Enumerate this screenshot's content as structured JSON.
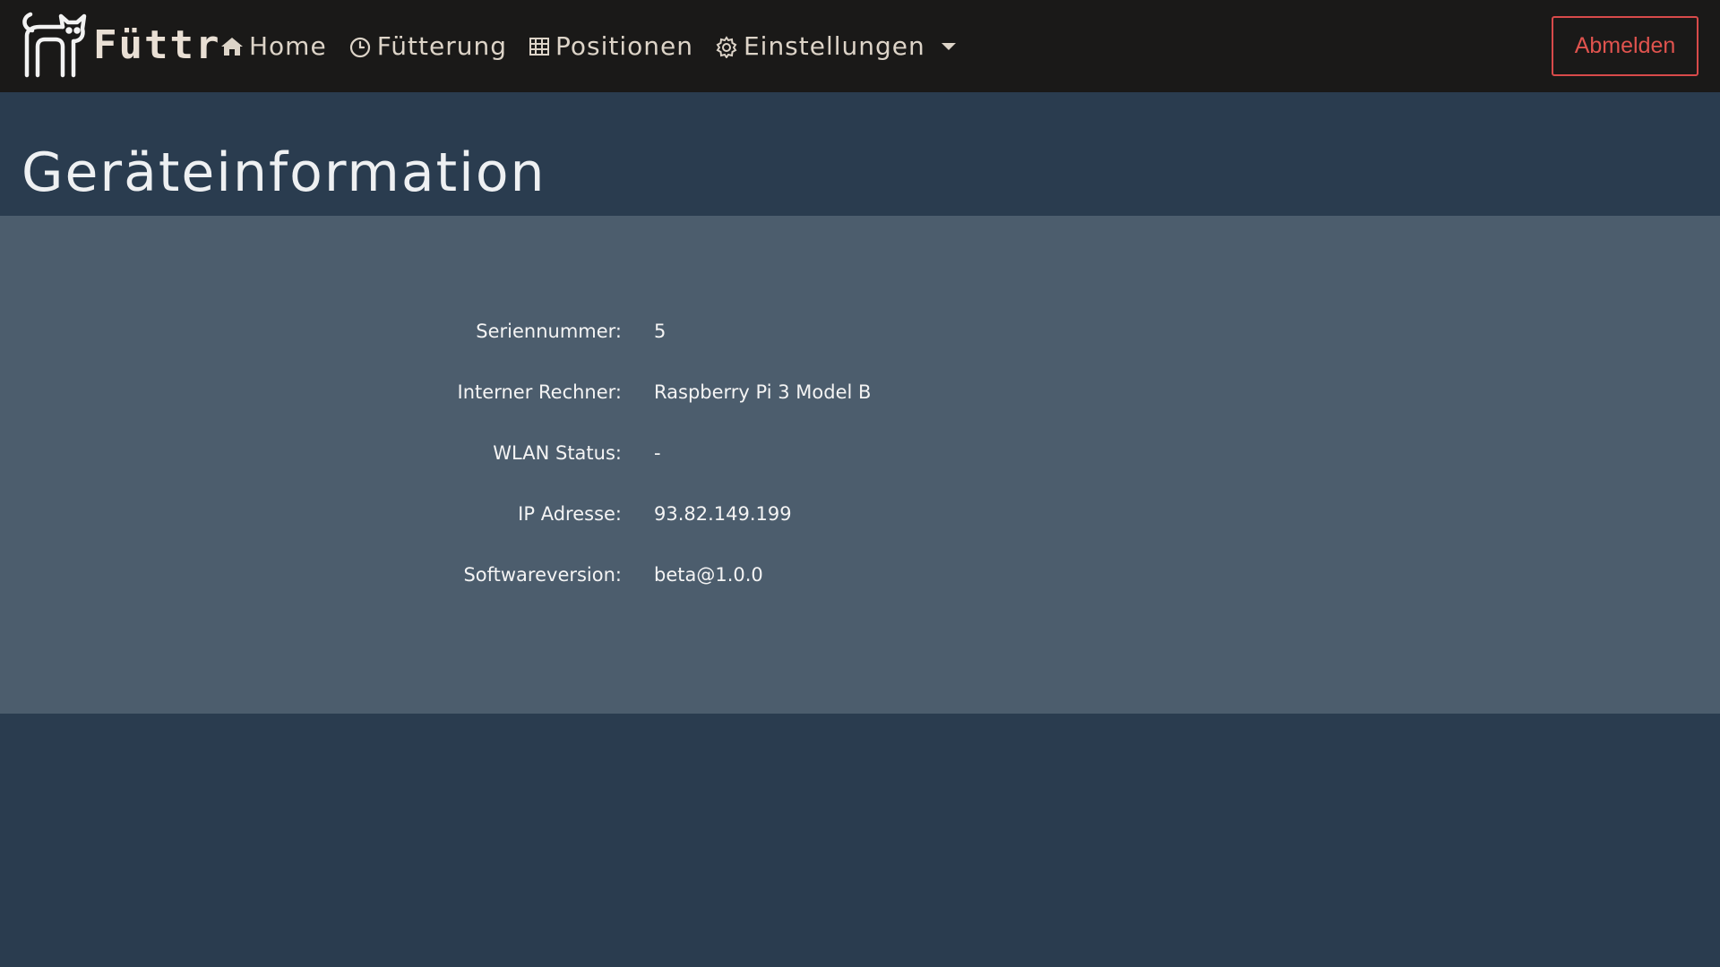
{
  "brand": {
    "name": "Füttr",
    "logo_icon": "cat-icon"
  },
  "nav": {
    "items": [
      {
        "label": "Home",
        "icon": "home-icon"
      },
      {
        "label": "Fütterung",
        "icon": "clock-icon"
      },
      {
        "label": "Positionen",
        "icon": "grid-icon"
      },
      {
        "label": "Einstellungen",
        "icon": "gear-icon"
      }
    ],
    "logout_label": "Abmelden"
  },
  "page": {
    "title": "Geräteinformation"
  },
  "device_info": [
    {
      "label": "Seriennummer:",
      "value": "5"
    },
    {
      "label": "Interner Rechner:",
      "value": "Raspberry Pi 3 Model B"
    },
    {
      "label": "WLAN Status:",
      "value": "-"
    },
    {
      "label": "IP Adresse:",
      "value": "93.82.149.199"
    },
    {
      "label": "Softwareversion:",
      "value": "beta@1.0.0"
    }
  ],
  "colors": {
    "navbar_bg": "#1a1918",
    "page_bg": "#2a3c4f",
    "panel_bg": "#4c5d6d",
    "logout_accent": "#d84a4a"
  }
}
